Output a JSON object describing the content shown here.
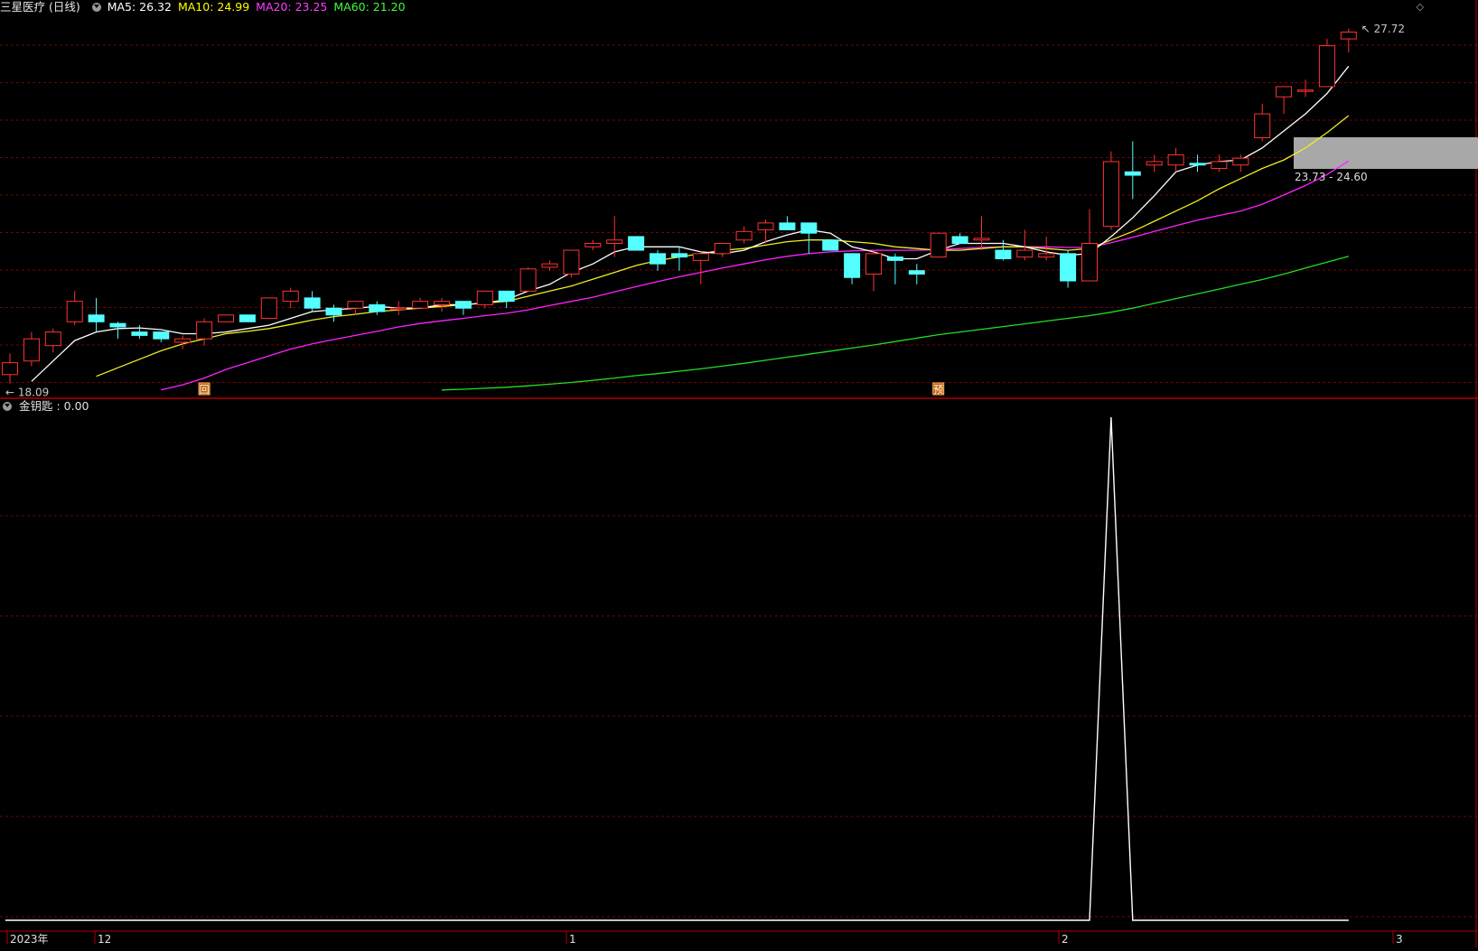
{
  "window": {
    "title": "三星医疗 (日线)"
  },
  "ma_legend": [
    {
      "label": "MA5: 26.32",
      "color": "#ffffff"
    },
    {
      "label": "MA10: 24.99",
      "color": "#ffff00"
    },
    {
      "label": "MA20: 23.25",
      "color": "#ff00ff"
    },
    {
      "label": "MA60: 21.20",
      "color": "#00e000"
    }
  ],
  "subchart": {
    "label": "金钥匙 : 0.00"
  },
  "annotations": {
    "high_label": "27.72",
    "low_label": "18.09",
    "zone_label": "23.73 - 24.60",
    "marker_hui": "回",
    "marker_yu": "预"
  },
  "x_axis": {
    "year": "2023年",
    "m12": "12",
    "m1": "1",
    "m2": "2",
    "m3": "3"
  },
  "colors": {
    "up": "#ff3232",
    "down": "#54ffff",
    "grid": "#7a0000",
    "border": "#b00000"
  },
  "chart_data": {
    "type": "candlestick",
    "series": {
      "candles": [
        [
          18.35,
          18.7,
          18.97,
          18.09
        ],
        [
          18.75,
          19.4,
          19.6,
          18.6
        ],
        [
          19.2,
          19.6,
          19.7,
          19.0
        ],
        [
          19.9,
          20.5,
          20.8,
          19.8
        ],
        [
          20.1,
          19.9,
          20.6,
          19.6
        ],
        [
          19.85,
          19.75,
          19.9,
          19.4
        ],
        [
          19.6,
          19.5,
          19.8,
          19.4
        ],
        [
          19.6,
          19.4,
          19.6,
          19.3
        ],
        [
          19.3,
          19.4,
          19.5,
          19.1
        ],
        [
          19.4,
          19.9,
          20.0,
          19.2
        ],
        [
          19.9,
          20.1,
          20.1,
          19.9
        ],
        [
          20.1,
          19.9,
          20.1,
          19.9
        ],
        [
          20.0,
          20.6,
          20.6,
          20.0
        ],
        [
          20.5,
          20.8,
          20.9,
          20.3
        ],
        [
          20.6,
          20.3,
          20.8,
          20.2
        ],
        [
          20.3,
          20.1,
          20.4,
          19.9
        ],
        [
          20.3,
          20.5,
          20.5,
          20.1
        ],
        [
          20.4,
          20.2,
          20.5,
          20.1
        ],
        [
          20.3,
          20.3,
          20.5,
          20.1
        ],
        [
          20.3,
          20.5,
          20.6,
          20.3
        ],
        [
          20.4,
          20.5,
          20.6,
          20.2
        ],
        [
          20.5,
          20.3,
          20.5,
          20.1
        ],
        [
          20.4,
          20.8,
          20.8,
          20.3
        ],
        [
          20.8,
          20.5,
          20.8,
          20.3
        ],
        [
          20.8,
          21.45,
          21.5,
          20.8
        ],
        [
          21.5,
          21.6,
          21.7,
          21.4
        ],
        [
          21.3,
          22.0,
          22.0,
          21.2
        ],
        [
          22.1,
          22.2,
          22.3,
          22.0
        ],
        [
          22.2,
          22.3,
          23.0,
          21.8
        ],
        [
          22.4,
          22.0,
          22.4,
          22.0
        ],
        [
          21.9,
          21.6,
          22.0,
          21.4
        ],
        [
          21.9,
          21.8,
          22.1,
          21.4
        ],
        [
          21.7,
          21.9,
          21.9,
          21.0
        ],
        [
          21.9,
          22.2,
          22.2,
          21.8
        ],
        [
          22.3,
          22.55,
          22.7,
          22.2
        ],
        [
          22.6,
          22.8,
          22.9,
          22.2
        ],
        [
          22.8,
          22.6,
          23.0,
          22.6
        ],
        [
          22.8,
          22.5,
          22.8,
          21.9
        ],
        [
          22.3,
          22.0,
          22.3,
          22.0
        ],
        [
          21.9,
          21.2,
          21.9,
          21.0
        ],
        [
          21.3,
          21.9,
          22.0,
          20.8
        ],
        [
          21.8,
          21.7,
          21.9,
          21.0
        ],
        [
          21.4,
          21.3,
          21.6,
          21.0
        ],
        [
          21.8,
          22.5,
          22.5,
          21.8
        ],
        [
          22.4,
          22.2,
          22.5,
          22.2
        ],
        [
          22.3,
          22.35,
          23.0,
          22.0
        ],
        [
          22.0,
          21.75,
          22.3,
          21.7
        ],
        [
          21.8,
          22.0,
          22.6,
          21.7
        ],
        [
          21.8,
          21.9,
          22.4,
          21.7
        ],
        [
          21.9,
          21.1,
          22.0,
          20.9
        ],
        [
          21.1,
          22.2,
          23.2,
          21.1
        ],
        [
          22.7,
          24.6,
          24.9,
          22.6
        ],
        [
          24.3,
          24.2,
          25.2,
          23.5
        ],
        [
          24.5,
          24.6,
          24.8,
          24.3
        ],
        [
          24.5,
          24.8,
          25.0,
          24.3
        ],
        [
          24.55,
          24.5,
          24.8,
          24.3
        ],
        [
          24.4,
          24.6,
          24.8,
          24.3
        ],
        [
          24.5,
          24.7,
          24.8,
          24.3
        ],
        [
          25.3,
          26.0,
          26.3,
          25.2
        ],
        [
          26.5,
          26.8,
          26.8,
          26.0
        ],
        [
          26.7,
          26.7,
          27.0,
          26.5
        ],
        [
          26.8,
          28.0,
          28.2,
          26.8
        ],
        [
          28.2,
          28.4,
          28.5,
          27.8
        ]
      ],
      "ma5": [
        null,
        18.15,
        18.75,
        19.35,
        19.6,
        19.7,
        19.72,
        19.67,
        19.55,
        19.55,
        19.6,
        19.7,
        19.8,
        20.0,
        20.2,
        20.25,
        20.3,
        20.35,
        20.3,
        20.3,
        20.4,
        20.4,
        20.45,
        20.55,
        20.8,
        21.0,
        21.35,
        21.6,
        21.95,
        22.1,
        22.1,
        22.1,
        21.95,
        21.9,
        22.0,
        22.25,
        22.45,
        22.6,
        22.5,
        22.1,
        21.95,
        21.75,
        21.75,
        22.0,
        22.2,
        22.2,
        22.2,
        22.1,
        21.95,
        21.85,
        21.9,
        22.4,
        22.95,
        23.6,
        24.3,
        24.5,
        24.6,
        24.65,
        25.0,
        25.5,
        26.0,
        26.6,
        27.4
      ],
      "ma10": [
        null,
        null,
        null,
        null,
        18.3,
        18.55,
        18.8,
        19.05,
        19.25,
        19.4,
        19.55,
        19.62,
        19.7,
        19.82,
        19.95,
        20.05,
        20.12,
        20.2,
        20.25,
        20.3,
        20.35,
        20.4,
        20.45,
        20.5,
        20.65,
        20.8,
        20.95,
        21.15,
        21.35,
        21.55,
        21.7,
        21.8,
        21.9,
        22.0,
        22.05,
        22.15,
        22.25,
        22.3,
        22.3,
        22.25,
        22.2,
        22.1,
        22.05,
        22.0,
        22.0,
        22.05,
        22.1,
        22.1,
        22.05,
        22.0,
        22.05,
        22.3,
        22.55,
        22.85,
        23.15,
        23.45,
        23.8,
        24.1,
        24.4,
        24.65,
        25.0,
        25.45,
        25.95
      ],
      "ma20": [
        null,
        null,
        null,
        null,
        null,
        null,
        null,
        17.9,
        18.05,
        18.25,
        18.5,
        18.7,
        18.9,
        19.1,
        19.25,
        19.38,
        19.5,
        19.62,
        19.75,
        19.85,
        19.93,
        20.0,
        20.08,
        20.15,
        20.25,
        20.38,
        20.5,
        20.62,
        20.78,
        20.93,
        21.08,
        21.22,
        21.35,
        21.48,
        21.6,
        21.72,
        21.82,
        21.9,
        21.95,
        21.98,
        22.0,
        22.0,
        22.0,
        22.02,
        22.05,
        22.08,
        22.1,
        22.1,
        22.1,
        22.08,
        22.08,
        22.22,
        22.38,
        22.55,
        22.72,
        22.88,
        23.02,
        23.15,
        23.35,
        23.62,
        23.9,
        24.22,
        24.62
      ],
      "ma60": [
        null,
        null,
        null,
        null,
        null,
        null,
        null,
        null,
        null,
        null,
        null,
        null,
        null,
        null,
        null,
        null,
        null,
        null,
        null,
        null,
        17.9,
        17.92,
        17.95,
        17.98,
        18.02,
        18.07,
        18.12,
        18.18,
        18.25,
        18.32,
        18.38,
        18.45,
        18.52,
        18.6,
        18.68,
        18.77,
        18.86,
        18.95,
        19.04,
        19.13,
        19.22,
        19.32,
        19.42,
        19.52,
        19.6,
        19.68,
        19.76,
        19.84,
        19.92,
        20.0,
        20.08,
        20.18,
        20.3,
        20.44,
        20.58,
        20.72,
        20.86,
        21.0,
        21.14,
        21.3,
        21.48,
        21.65,
        21.82
      ]
    },
    "y_range": [
      18.0,
      28.6
    ],
    "indicator": {
      "name": "金钥匙",
      "value": 0.0,
      "spike_index": 51,
      "spike_value": 1.0
    }
  }
}
